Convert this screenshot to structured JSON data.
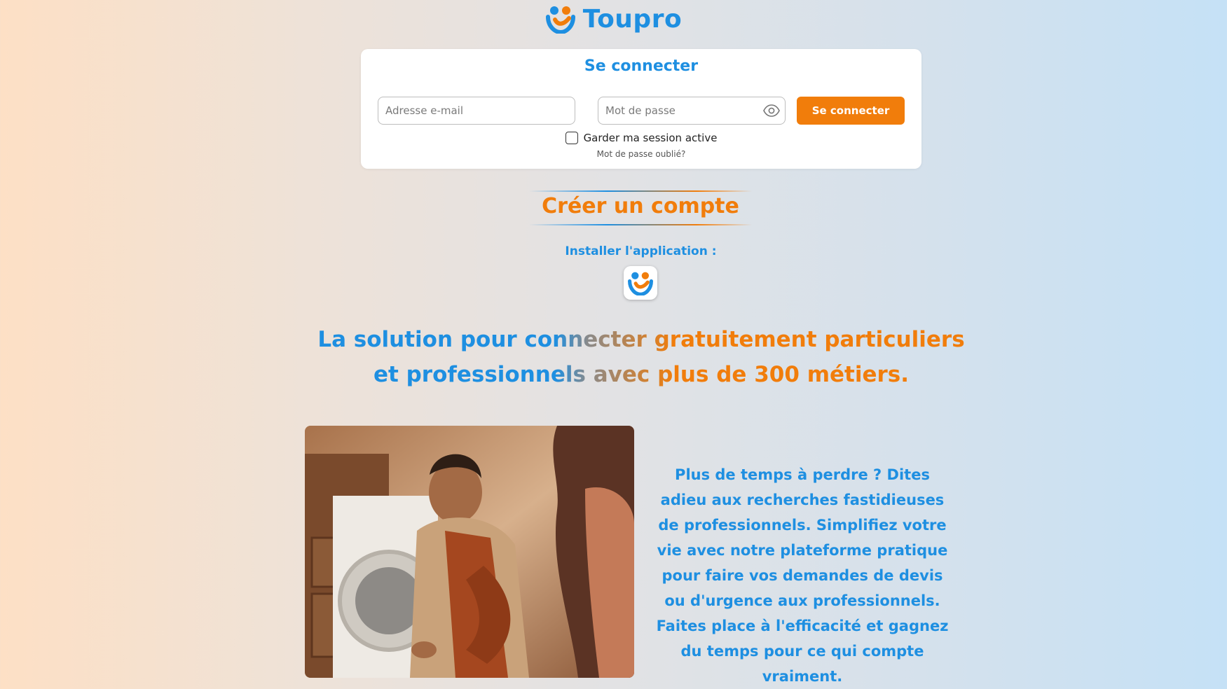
{
  "brand": {
    "name": "Toupro",
    "logo_icon": "toupro-logo-icon"
  },
  "login": {
    "title": "Se connecter",
    "email_placeholder": "Adresse e-mail",
    "password_placeholder": "Mot de passe",
    "show_password_icon": "eye-icon",
    "submit_label": "Se connecter",
    "remember_label": "Garder ma session active",
    "remember_checked": false,
    "forgot_label": "Mot de passe oublié?"
  },
  "create_account": {
    "label": "Créer un compte"
  },
  "install": {
    "label": "Installer l'application :",
    "app_icon": "toupro-app-icon"
  },
  "tagline": "La solution pour connecter gratuitement particuliers et professionnels avec plus de 300 métiers.",
  "hero": {
    "image_icon": "technician-photo",
    "description": "Plus de temps à perdre ? Dites adieu aux recherches fastidieuses de professionnels. Simplifiez votre vie avec notre plateforme pratique pour faire vos demandes de devis ou d'urgence aux professionnels. Faites place à l'efficacité et gagnez du temps pour ce qui compte vraiment."
  },
  "colors": {
    "brand_blue": "#1e8fe1",
    "brand_orange": "#f17d0b"
  }
}
